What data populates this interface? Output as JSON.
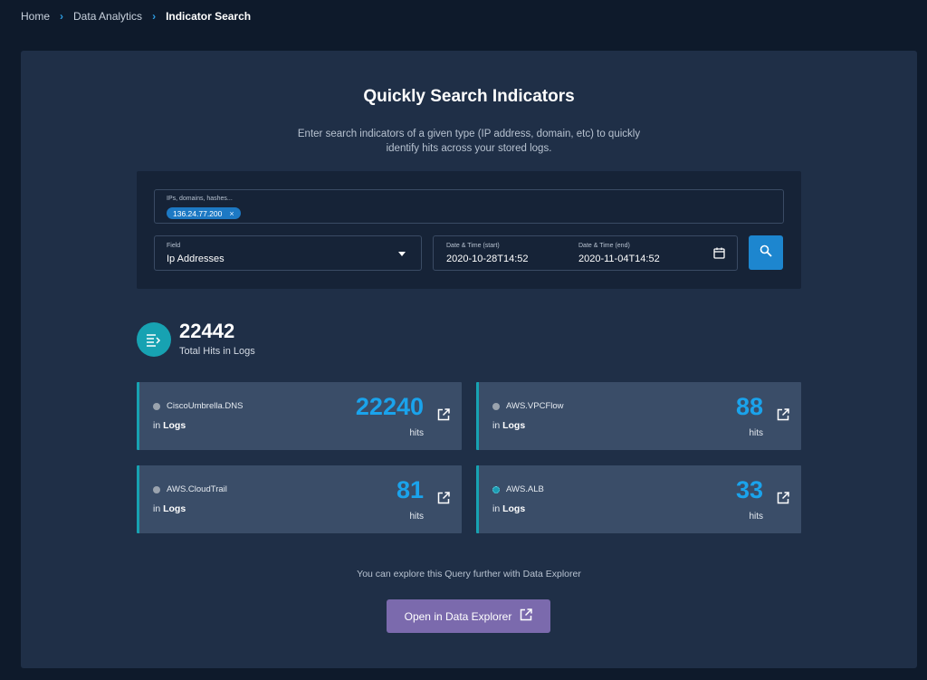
{
  "breadcrumb": {
    "items": [
      "Home",
      "Data Analytics",
      "Indicator Search"
    ]
  },
  "header": {
    "title": "Quickly Search Indicators",
    "description": "Enter search indicators of a given type (IP address, domain, etc) to quickly identify hits across your stored logs."
  },
  "search": {
    "indicators_placeholder": "IPs, domains, hashes...",
    "chips": [
      "136.24.77.200"
    ],
    "field_label": "Field",
    "field_value": "Ip Addresses",
    "start_label": "Date & Time (start)",
    "start_value": "2020-10-28T14:52",
    "end_label": "Date & Time (end)",
    "end_value": "2020-11-04T14:52"
  },
  "total": {
    "value": "22442",
    "label": "Total Hits in Logs"
  },
  "cards": [
    {
      "source": "CiscoUmbrella.DNS",
      "in": "in",
      "logs": "Logs",
      "hits": "22240",
      "hits_label": "hits"
    },
    {
      "source": "AWS.VPCFlow",
      "in": "in",
      "logs": "Logs",
      "hits": "88",
      "hits_label": "hits"
    },
    {
      "source": "AWS.CloudTrail",
      "in": "in",
      "logs": "Logs",
      "hits": "81",
      "hits_label": "hits"
    },
    {
      "source": "AWS.ALB",
      "in": "in",
      "logs": "Logs",
      "hits": "33",
      "hits_label": "hits"
    }
  ],
  "explore": {
    "text": "You can explore this Query further with Data Explorer",
    "button_label": "Open in Data Explorer"
  },
  "colors": {
    "background": "#0e1a2b",
    "panel": "#1f2f47",
    "accent_teal": "#17a2b2",
    "hits_blue": "#1aa3ec",
    "primary_button": "#1d86cf",
    "explore_button": "#7b6aad"
  },
  "icons": {
    "breadcrumb_separator": "chevron-right-icon",
    "field_select": "caret-down-icon",
    "date": "calendar-icon",
    "search": "search-icon",
    "total": "log-list-icon",
    "card_link": "external-link-icon"
  }
}
